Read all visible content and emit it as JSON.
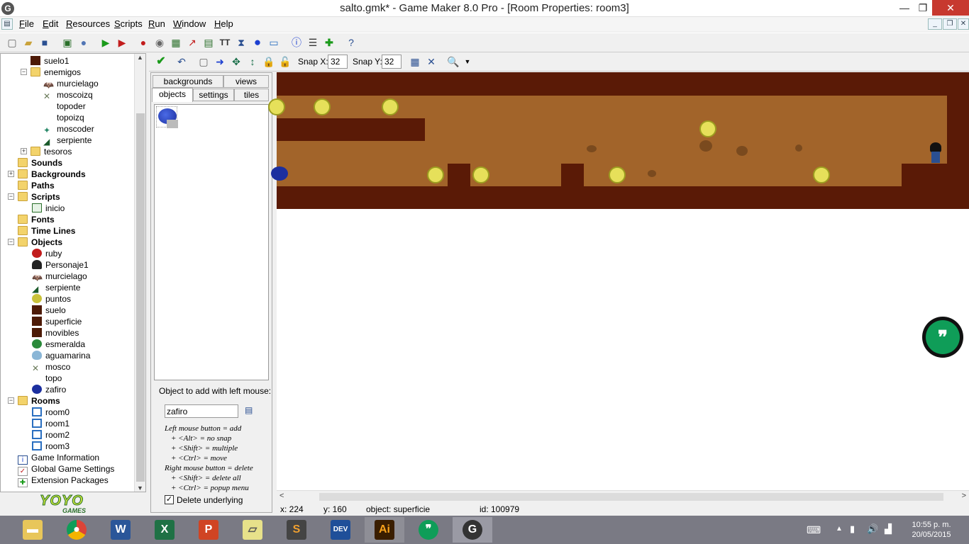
{
  "window": {
    "title": "salto.gmk* - Game Maker 8.0 Pro - [Room Properties: room3]"
  },
  "menu": [
    "File",
    "Edit",
    "Resources",
    "Scripts",
    "Run",
    "Window",
    "Help"
  ],
  "tree": {
    "items": [
      {
        "label": "suelo1"
      },
      {
        "label": "enemigos"
      },
      {
        "label": "murcielago"
      },
      {
        "label": "moscoizq"
      },
      {
        "label": "topoder"
      },
      {
        "label": "topoizq"
      },
      {
        "label": "moscoder"
      },
      {
        "label": "serpiente"
      },
      {
        "label": "tesoros"
      },
      {
        "label": "Sounds"
      },
      {
        "label": "Backgrounds"
      },
      {
        "label": "Paths"
      },
      {
        "label": "Scripts"
      },
      {
        "label": "inicio"
      },
      {
        "label": "Fonts"
      },
      {
        "label": "Time Lines"
      },
      {
        "label": "Objects"
      },
      {
        "label": "ruby"
      },
      {
        "label": "Personaje1"
      },
      {
        "label": "murcielago"
      },
      {
        "label": "serpiente"
      },
      {
        "label": "puntos"
      },
      {
        "label": "suelo"
      },
      {
        "label": "superficie"
      },
      {
        "label": "movibles"
      },
      {
        "label": "esmeralda"
      },
      {
        "label": "aguamarina"
      },
      {
        "label": "mosco"
      },
      {
        "label": "topo"
      },
      {
        "label": "zafiro"
      },
      {
        "label": "Rooms"
      },
      {
        "label": "room0"
      },
      {
        "label": "room1"
      },
      {
        "label": "room2"
      },
      {
        "label": "room3"
      },
      {
        "label": "Game Information"
      },
      {
        "label": "Global Game Settings"
      },
      {
        "label": "Extension Packages"
      }
    ]
  },
  "logo": {
    "text": "YOYO",
    "sub": "GAMES"
  },
  "room_toolbar": {
    "snap_x_label": "Snap X:",
    "snap_x": "32",
    "snap_y_label": "Snap Y:",
    "snap_y": "32"
  },
  "tabs": {
    "backgrounds": "backgrounds",
    "views": "views",
    "objects": "objects",
    "settings": "settings",
    "tiles": "tiles"
  },
  "panel": {
    "add_label": "Object to add with left mouse:",
    "object_field": "zafiro",
    "help_lines": [
      "Left mouse button = add",
      "+ <Alt> = no snap",
      "+ <Shift> = multiple",
      "+ <Ctrl> = move",
      "Right mouse button = delete",
      "+ <Shift> = delete all",
      "+ <Ctrl> = popup menu"
    ],
    "delete_underlying": "Delete underlying"
  },
  "status": {
    "x": "x: 224",
    "y": "y: 160",
    "object": "object: superficie",
    "id": "id: 100979"
  },
  "taskbar": {
    "time": "10:55 p. m.",
    "date": "20/05/2015"
  },
  "colors": {
    "room_bg": "#5a1a06",
    "room_fill": "#a2642a",
    "coin": "#e6e05a",
    "accent": "#0f9d58"
  }
}
